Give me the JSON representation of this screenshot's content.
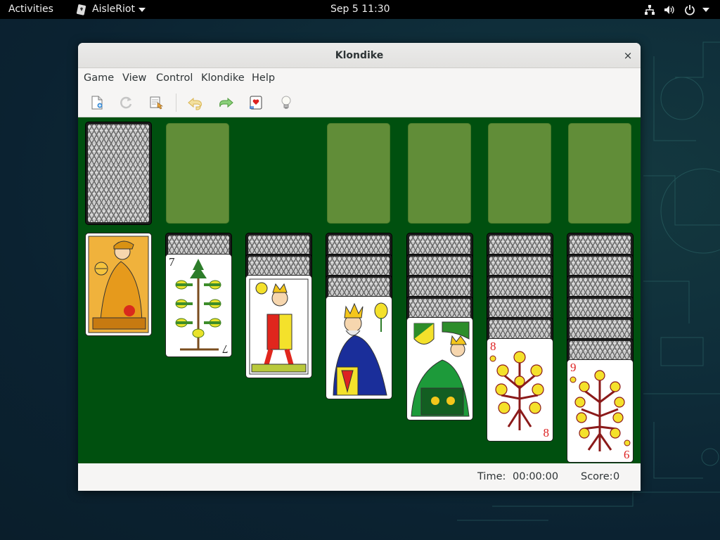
{
  "topbar": {
    "activities": "Activities",
    "app_name": "AisleRiot",
    "clock": "Sep 5  11:30"
  },
  "window": {
    "title": "Klondike",
    "close_glyph": "×"
  },
  "menubar": {
    "items": [
      "Game",
      "View",
      "Control",
      "Klondike",
      "Help"
    ]
  },
  "toolbar": {
    "icons": [
      "new-game-icon",
      "restart-icon",
      "select-game-icon",
      "undo-icon",
      "redo-icon",
      "deal-icon",
      "hint-icon"
    ]
  },
  "board": {
    "background": "#00500f",
    "slot_color": "#618d38",
    "stock": "face-down",
    "foundations": [
      "empty",
      "empty",
      "empty",
      "empty"
    ],
    "tableau": [
      {
        "face_down": 0,
        "top": "knave of coins"
      },
      {
        "face_down": 1,
        "top": "7 of acorns",
        "rank": "7"
      },
      {
        "face_down": 2,
        "top": "knave of flowers"
      },
      {
        "face_down": 3,
        "top": "king of acorns"
      },
      {
        "face_down": 4,
        "top": "king of shields"
      },
      {
        "face_down": 5,
        "top": "8 of flowers",
        "rank": "8"
      },
      {
        "face_down": 6,
        "top": "9 of flowers",
        "rank": "9"
      }
    ]
  },
  "status": {
    "time_label": "Time:",
    "time_value": "00:00:00",
    "score_label": "Score:",
    "score_value": "0"
  }
}
